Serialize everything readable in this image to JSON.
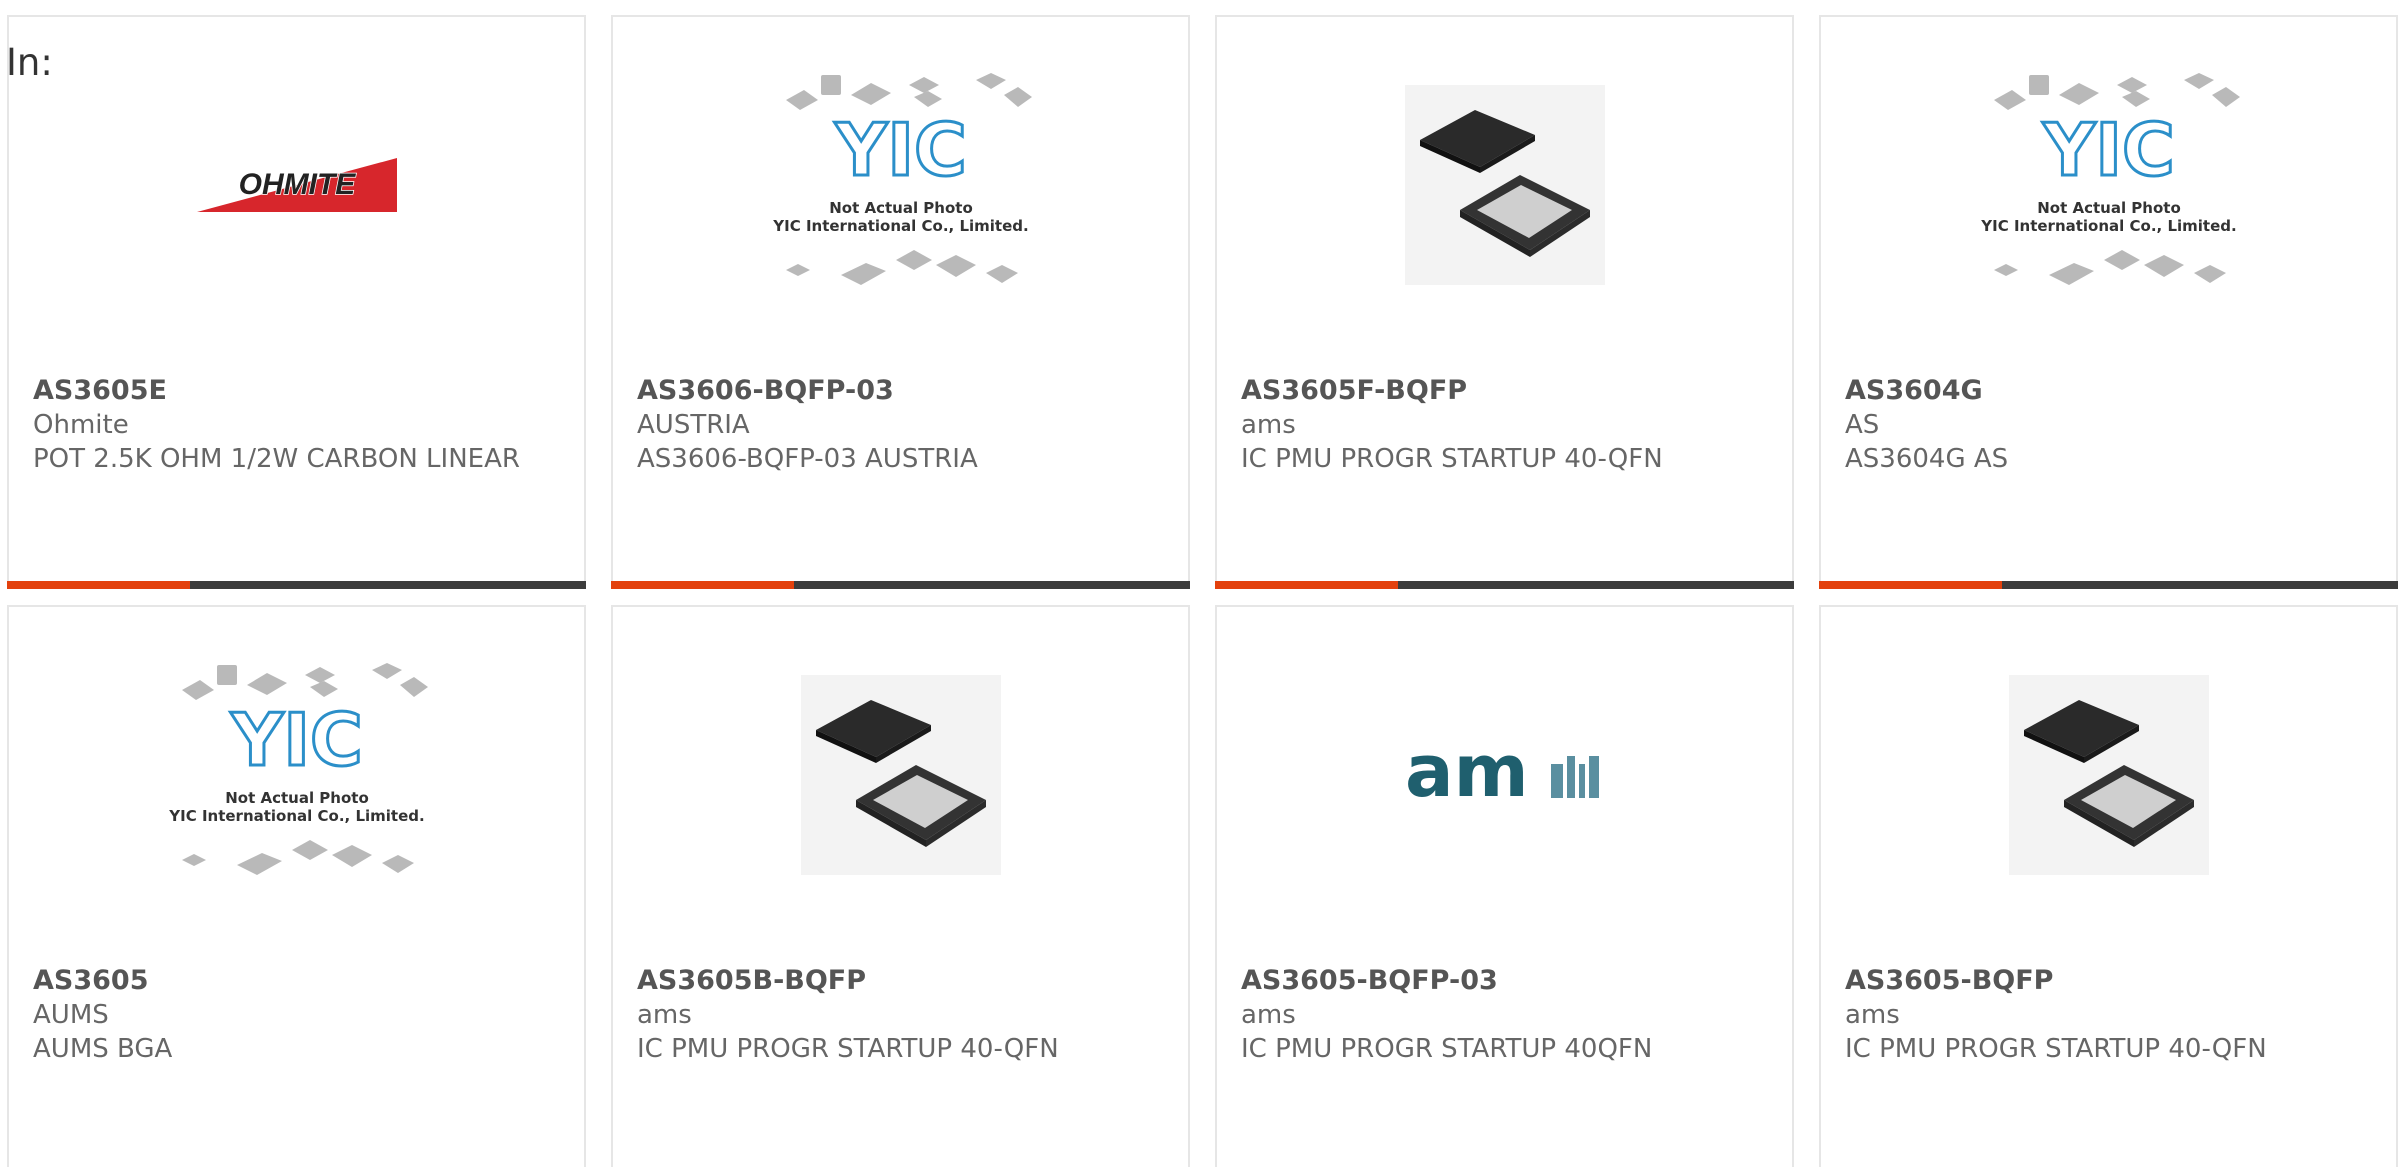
{
  "filter_label": "In:",
  "products": [
    {
      "part_number": "AS3605E",
      "manufacturer": "Ohmite",
      "description": "POT 2.5K OHM 1/2W CARBON LINEAR",
      "image": "ohmite-logo",
      "logo_text": "OHMITE"
    },
    {
      "part_number": "AS3606-BQFP-03",
      "manufacturer": "AUSTRIA",
      "description": "AS3606-BQFP-03 AUSTRIA",
      "image": "yic-placeholder",
      "placeholder_line1": "Not Actual Photo",
      "placeholder_line2": "YIC International Co., Limited."
    },
    {
      "part_number": "AS3605F-BQFP",
      "manufacturer": "ams",
      "description": "IC PMU PROGR STARTUP 40-QFN",
      "image": "qfn-chip-photo"
    },
    {
      "part_number": "AS3604G",
      "manufacturer": "AS",
      "description": "AS3604G AS",
      "image": "yic-placeholder",
      "placeholder_line1": "Not Actual Photo",
      "placeholder_line2": "YIC International Co., Limited."
    },
    {
      "part_number": "AS3605",
      "manufacturer": "AUMS",
      "description": "AUMS BGA",
      "image": "yic-placeholder",
      "placeholder_line1": "Not Actual Photo",
      "placeholder_line2": "YIC International Co., Limited."
    },
    {
      "part_number": "AS3605B-BQFP",
      "manufacturer": "ams",
      "description": "IC PMU PROGR STARTUP 40-QFN",
      "image": "qfn-chip-photo"
    },
    {
      "part_number": "AS3605-BQFP-03",
      "manufacturer": "ams",
      "description": "IC PMU PROGR STARTUP 40QFN",
      "image": "ams-logo",
      "logo_text": "am"
    },
    {
      "part_number": "AS3605-BQFP",
      "manufacturer": "ams",
      "description": "IC PMU PROGR STARTUP 40-QFN",
      "image": "qfn-chip-photo"
    }
  ],
  "colors": {
    "accent": "#e3410d",
    "bar_dark": "#3c3c3c",
    "text": "#666666",
    "ohmite_red": "#d7262c",
    "ams_teal": "#1f5f6e",
    "yic_blue": "#2b8fc9"
  }
}
